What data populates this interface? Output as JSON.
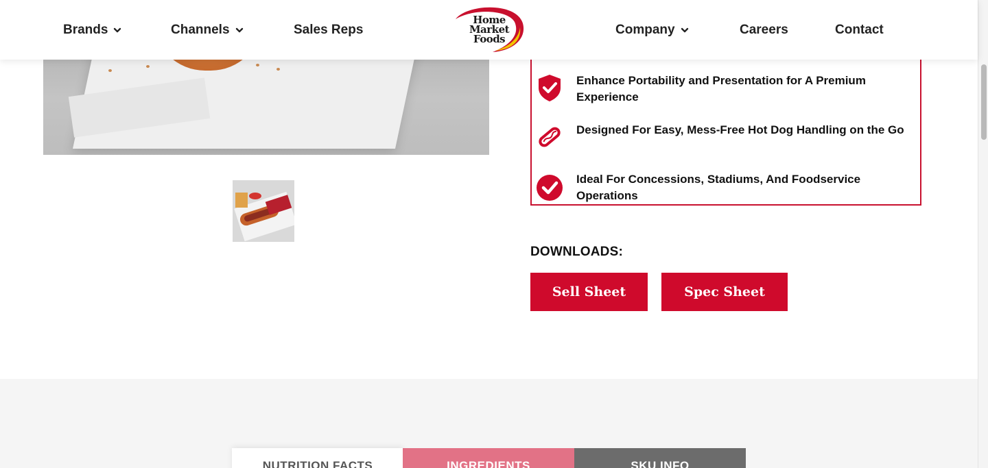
{
  "header": {
    "nav_left": [
      {
        "label": "Brands",
        "has_dropdown": true
      },
      {
        "label": "Channels",
        "has_dropdown": true
      },
      {
        "label": "Sales Reps",
        "has_dropdown": false
      }
    ],
    "logo": {
      "line1": "Home",
      "line2": "Market",
      "line3": "Foods",
      "icon": "home-market-foods-logo"
    },
    "nav_right": [
      {
        "label": "Company",
        "has_dropdown": true
      },
      {
        "label": "Careers",
        "has_dropdown": false
      },
      {
        "label": "Contact",
        "has_dropdown": false
      }
    ]
  },
  "features": [
    {
      "icon": "shield-check-icon",
      "text": "Enhance Portability and Presentation for A Premium Experience"
    },
    {
      "icon": "hot-dog-icon",
      "text": "Designed For Easy, Mess-Free Hot Dog Handling on the Go"
    },
    {
      "icon": "check-circle-icon",
      "text": "Ideal For Concessions, Stadiums, And Foodservice Operations"
    }
  ],
  "downloads": {
    "label": "DOWNLOADS:",
    "buttons": [
      {
        "label": "Sell Sheet"
      },
      {
        "label": "Spec Sheet"
      }
    ]
  },
  "tabs": [
    {
      "label": "NUTRITION FACTS",
      "active": false
    },
    {
      "label": "INGREDIENTS",
      "active": true
    },
    {
      "label": "SKU INFO",
      "active": false
    }
  ],
  "colors": {
    "brand_red": "#cf0a2c",
    "border_red": "#c8102e",
    "tab_inactive_bg": "#ffffff",
    "tab_active_bg": "#e27286",
    "tab_dark_bg": "#6c6c6c"
  }
}
